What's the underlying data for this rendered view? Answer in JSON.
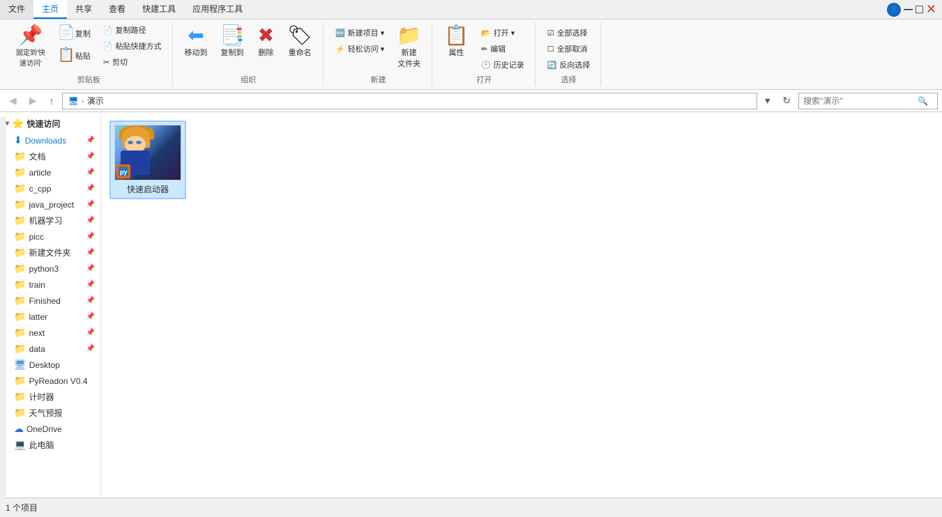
{
  "ribbon": {
    "tabs": [
      "文件",
      "主页",
      "共享",
      "查看",
      "快建工具",
      "应用程序工具"
    ],
    "groups": {
      "clipboard": {
        "label": "剪贴板",
        "items": [
          {
            "id": "pin",
            "icon": "📌",
            "label": "固定到'快\n速访问'"
          },
          {
            "id": "copy",
            "icon": "📋",
            "label": "复制"
          },
          {
            "id": "paste",
            "icon": "📋",
            "label": "粘贴"
          }
        ],
        "small": [
          {
            "id": "copy-path",
            "icon": "📄",
            "label": "复制路径"
          },
          {
            "id": "paste-shortcut",
            "icon": "📄",
            "label": "粘贴快捷方式"
          },
          {
            "id": "cut",
            "icon": "✂",
            "label": "剪切"
          }
        ]
      },
      "organize": {
        "label": "组织",
        "items": [
          {
            "id": "move",
            "icon": "⬅",
            "label": "移动到"
          },
          {
            "id": "copy-to",
            "icon": "📑",
            "label": "复制到"
          },
          {
            "id": "delete",
            "icon": "✖",
            "label": "删除"
          },
          {
            "id": "rename",
            "icon": "🏷",
            "label": "重命名"
          }
        ]
      },
      "new": {
        "label": "新建",
        "items": [
          {
            "id": "new-item",
            "icon": "🆕",
            "label": "新建项目"
          },
          {
            "id": "easy-access",
            "icon": "⚡",
            "label": "轻松访问"
          },
          {
            "id": "new-folder",
            "icon": "📁",
            "label": "新建\n文件夹"
          }
        ]
      },
      "open": {
        "label": "打开",
        "items": [
          {
            "id": "properties",
            "icon": "📋",
            "label": "属性"
          },
          {
            "id": "open",
            "icon": "📂",
            "label": "打开"
          },
          {
            "id": "edit",
            "icon": "✏",
            "label": "编辑"
          },
          {
            "id": "history",
            "icon": "🕐",
            "label": "历史记录"
          }
        ]
      },
      "select": {
        "label": "选择",
        "items": [
          {
            "id": "select-all",
            "icon": "☑",
            "label": "全部选择"
          },
          {
            "id": "deselect",
            "icon": "☐",
            "label": "全部取消"
          },
          {
            "id": "invert",
            "icon": "🔄",
            "label": "反向选择"
          }
        ]
      }
    }
  },
  "addressbar": {
    "back_disabled": true,
    "forward_disabled": true,
    "up_label": "↑",
    "path": "演示",
    "search_placeholder": "搜索\"演示\""
  },
  "sidebar": {
    "quick_access_label": "快速访问",
    "items": [
      {
        "id": "downloads",
        "label": "Downloads",
        "type": "special-blue",
        "pinned": true
      },
      {
        "id": "documents",
        "label": "文档",
        "type": "folder",
        "pinned": true
      },
      {
        "id": "article",
        "label": "article",
        "type": "folder",
        "pinned": true
      },
      {
        "id": "c_cpp",
        "label": "c_cpp",
        "type": "folder",
        "pinned": true
      },
      {
        "id": "java_project",
        "label": "java_project",
        "type": "folder",
        "pinned": true
      },
      {
        "id": "machine_learning",
        "label": "机器学习",
        "type": "folder",
        "pinned": true
      },
      {
        "id": "picc",
        "label": "picc",
        "type": "folder",
        "pinned": true
      },
      {
        "id": "new_folder",
        "label": "新建文件夹",
        "type": "folder",
        "pinned": true
      },
      {
        "id": "python3",
        "label": "python3",
        "type": "folder",
        "pinned": true
      },
      {
        "id": "train",
        "label": "train",
        "type": "folder",
        "pinned": true
      },
      {
        "id": "finished",
        "label": "Finished",
        "type": "folder",
        "pinned": true
      },
      {
        "id": "latter",
        "label": "latter",
        "type": "folder",
        "pinned": true
      },
      {
        "id": "next",
        "label": "next",
        "type": "folder",
        "pinned": true
      },
      {
        "id": "data",
        "label": "data",
        "type": "folder",
        "pinned": true
      },
      {
        "id": "desktop",
        "label": "Desktop",
        "type": "folder-blue"
      },
      {
        "id": "pyreadon",
        "label": "PyReadon V0.4",
        "type": "folder-yellow"
      },
      {
        "id": "timer",
        "label": "计时器",
        "type": "folder-yellow"
      },
      {
        "id": "weather",
        "label": "天气预报",
        "type": "folder-yellow"
      },
      {
        "id": "onedrive",
        "label": "OneDrive",
        "type": "special-blue"
      },
      {
        "id": "thispc",
        "label": "此电脑",
        "type": "computer"
      }
    ]
  },
  "content": {
    "files": [
      {
        "id": "quick-launcher",
        "label": "快速启动器",
        "type": "exe-with-anime"
      }
    ]
  },
  "statusbar": {
    "text": "1 个项目"
  }
}
